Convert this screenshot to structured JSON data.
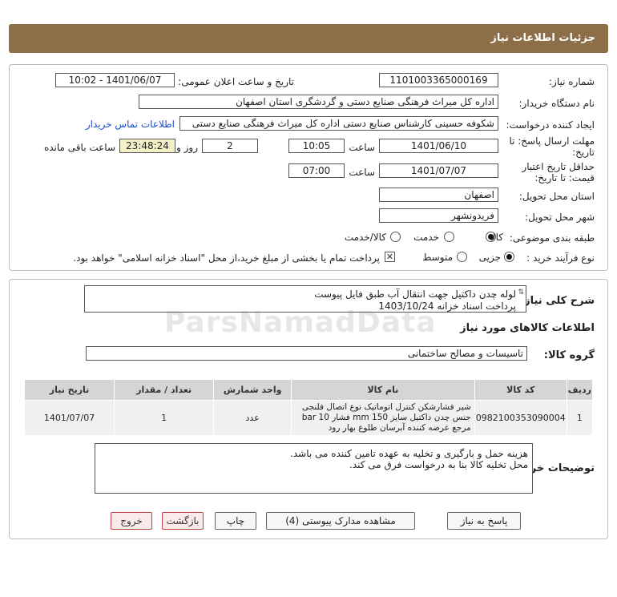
{
  "header": {
    "title": "جزئیات اطلاعات نیاز"
  },
  "form": {
    "need_number_label": "شماره نیاز:",
    "need_number": "1101003365000169",
    "announce_label": "تاریخ و ساعت اعلان عمومی:",
    "announce_value": "1401/06/07 - 10:02",
    "buyer_org_label": "نام دستگاه خریدار:",
    "buyer_org": "اداره کل میراث فرهنگی  صنایع دستی و گردشگری استان اصفهان",
    "requester_label": "ایجاد کننده درخواست:",
    "requester": "شکوفه حسینی کارشناس صنایع دستی اداره کل میراث فرهنگی  صنایع دستی",
    "contact_link": "اطلاعات تماس خریدار",
    "deadline_label_1": "مهلت ارسال پاسخ: تا",
    "deadline_label_2": "تاریخ:",
    "deadline_date": "1401/06/10",
    "time_label": "ساعت",
    "deadline_time": "10:05",
    "days_value": "2",
    "days_label": "روز و",
    "remaining_time": "23:48:24",
    "remaining_label": "ساعت باقی مانده",
    "validity_label_1": "حداقل تاریخ اعتبار",
    "validity_label_2": "قیمت: تا تاریخ:",
    "validity_date": "1401/07/07",
    "validity_time_label": "ساعت",
    "validity_time": "07:00",
    "province_label": "استان محل تحویل:",
    "province": "اصفهان",
    "city_label": "شهر محل تحویل:",
    "city": "فریدونشهر",
    "category_label": "طبقه بندی موضوعی:",
    "category_options": [
      "کالا",
      "خدمت",
      "کالا/خدمت"
    ],
    "category_selected": "کالا",
    "process_label": "نوع فرآیند خرید :",
    "process_options": [
      "جزیی",
      "متوسط"
    ],
    "process_selected": "جزیی",
    "treasury_note": "پرداخت تمام یا بخشی از مبلغ خرید،از محل \"اسناد خزانه اسلامی\" خواهد بود."
  },
  "details": {
    "summary_label": "شرح کلی نیاز:",
    "summary_line1": "لوله چدن داکتیل جهت انتقال آب طبق فایل پیوست",
    "summary_line2": "پرداخت اسناد خزانه 1403/10/24",
    "items_info_title": "اطلاعات کالاهای مورد نیاز",
    "goods_group_label": "گروه کالا:",
    "goods_group": "تاسیسات و مصالح ساختمانی"
  },
  "table": {
    "headers": [
      "ردیف",
      "کد کالا",
      "نام کالا",
      "واحد شمارش",
      "تعداد / مقدار",
      "تاریخ نیاز"
    ],
    "rows": [
      {
        "index": "1",
        "code": "0982100353090004",
        "name": "شیر فشارشکن کنترل اتوماتیک نوع اتصال فلنجی جنس چدن داکتیل سایز 150 mm فشار 10 bar مرجع عرضه کننده آبرسان طلوع بهار رود",
        "unit": "عدد",
        "qty": "1",
        "date": "1401/07/07"
      }
    ]
  },
  "buyer_notes": {
    "label": "توضیحات خریدار:",
    "line1": "هزینه حمل و بارگیری و تخلیه به عهده تامین کننده می باشد.",
    "line2": "محل تخلیه کالا بنا به درخواست فرق می کند."
  },
  "buttons": {
    "reply": "پاسخ به نیاز",
    "attachments": "مشاهده مدارک پیوستی (4)",
    "print": "چاپ",
    "back": "بازگشت",
    "exit": "خروج"
  },
  "watermark": {
    "brand": "ParsNamadData"
  }
}
